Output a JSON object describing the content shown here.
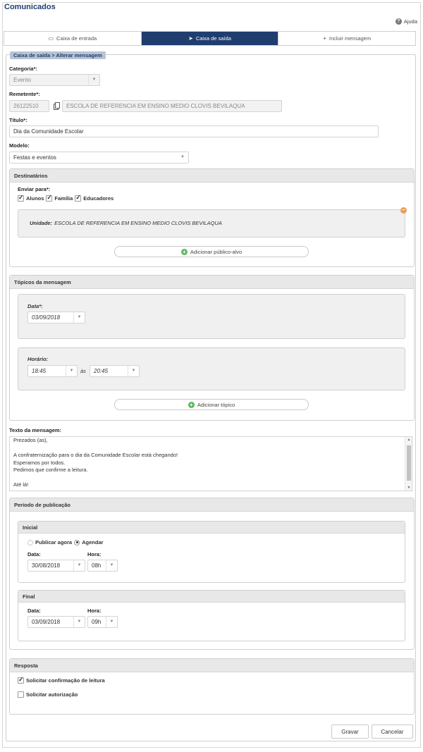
{
  "app_title": "Comunicados",
  "help_label": "Ajuda",
  "tabs": [
    {
      "label": "Caixa de entrada",
      "icon": "inbox-icon"
    },
    {
      "label": "Caixa de saída",
      "icon": "send-icon",
      "active": true
    },
    {
      "label": "Incluir mensagem",
      "icon": "plus-icon"
    }
  ],
  "breadcrumb": "Caixa de saída > Alterar mensagem",
  "form": {
    "categoria_label": "Categoria*:",
    "categoria_value": "Evento",
    "remetente_label": "Remetente*:",
    "remetente_code": "26122510",
    "remetente_name": "ESCOLA DE REFERENCIA EM ENSINO MEDIO CLOVIS BEVILAQUA",
    "titulo_label": "Título*:",
    "titulo_value": "Dia da Comunidade Escolar",
    "modelo_label": "Modelo:",
    "modelo_value": "Festas e eventos"
  },
  "destinatarios": {
    "title": "Destinatários",
    "enviar_label": "Enviar para*:",
    "options": [
      {
        "label": "Alunos",
        "checked": true
      },
      {
        "label": "Família",
        "checked": true
      },
      {
        "label": "Educadores",
        "checked": true
      }
    ],
    "unidade_label": "Unidade:",
    "unidade_value": "ESCOLA DE REFERENCIA EM ENSINO MEDIO CLOVIS BEVILAQUA",
    "add_button": "Adicionar público-alvo"
  },
  "topicos": {
    "title": "Tópicos da mensagem",
    "data_label": "Data*:",
    "data_value": "03/09/2018",
    "horario_label": "Horário:",
    "hora_inicio": "18:45",
    "as_label": "às",
    "hora_fim": "20:45",
    "add_button": "Adicionar tópico"
  },
  "texto": {
    "label": "Texto da mensagem:",
    "lines": [
      "Prezados (as),",
      "",
      "A confraternização para o dia da Comunidade Escolar está chegando!",
      "Esperamos por todos.",
      "Pedimos que confirme a leitura.",
      "",
      "Até lá!"
    ]
  },
  "periodo": {
    "title": "Período de publicação",
    "inicial_title": "Inicial",
    "publicar_agora": "Publicar agora",
    "agendar": "Agendar",
    "data_label": "Data:",
    "hora_label": "Hora:",
    "inicial_data": "30/08/2018",
    "inicial_hora": "08h",
    "final_title": "Final",
    "final_data": "03/09/2018",
    "final_hora": "09h"
  },
  "resposta": {
    "title": "Resposta",
    "confirmacao": "Solicitar confirmação de leitura",
    "autorizacao": "Solicitar autorização"
  },
  "buttons": {
    "save": "Gravar",
    "cancel": "Cancelar"
  }
}
